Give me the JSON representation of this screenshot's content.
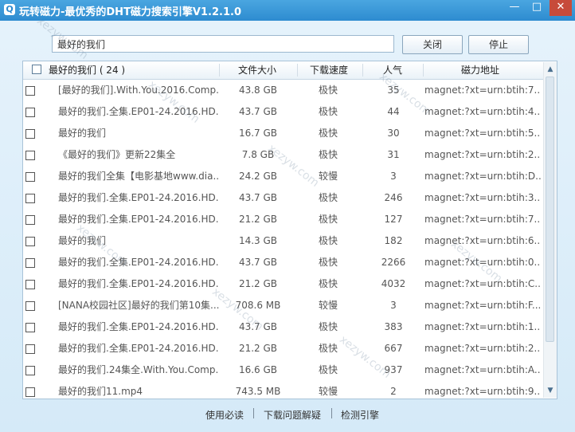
{
  "window": {
    "title": "玩转磁力-最优秀的DHT磁力搜索引擎V1.2.1.0",
    "minimize": "—",
    "maximize": "□",
    "close": "✕"
  },
  "search": {
    "value": "最好的我们"
  },
  "buttons": {
    "close_label": "关闭",
    "stop_label": "停止"
  },
  "table": {
    "headers": {
      "name": "最好的我们 ( 24 )",
      "size": "文件大小",
      "speed": "下载速度",
      "popularity": "人气",
      "magnet": "磁力地址"
    },
    "rows": [
      {
        "name": "[最好的我们].With.You.2016.Comp...",
        "size": "43.8 GB",
        "speed": "极快",
        "popularity": "35",
        "magnet": "magnet:?xt=urn:btih:7..."
      },
      {
        "name": "最好的我们.全集.EP01-24.2016.HD...",
        "size": "43.7 GB",
        "speed": "极快",
        "popularity": "44",
        "magnet": "magnet:?xt=urn:btih:4..."
      },
      {
        "name": "最好的我们",
        "size": "16.7 GB",
        "speed": "极快",
        "popularity": "30",
        "magnet": "magnet:?xt=urn:btih:5..."
      },
      {
        "name": "《最好的我们》更新22集全",
        "size": "7.8 GB",
        "speed": "极快",
        "popularity": "31",
        "magnet": "magnet:?xt=urn:btih:2..."
      },
      {
        "name": "最好的我们全集【电影基地www.dia...",
        "size": "24.2 GB",
        "speed": "较慢",
        "popularity": "3",
        "magnet": "magnet:?xt=urn:btih:D..."
      },
      {
        "name": "最好的我们.全集.EP01-24.2016.HD...",
        "size": "43.7 GB",
        "speed": "极快",
        "popularity": "246",
        "magnet": "magnet:?xt=urn:btih:3..."
      },
      {
        "name": "最好的我们.全集.EP01-24.2016.HD...",
        "size": "21.2 GB",
        "speed": "极快",
        "popularity": "127",
        "magnet": "magnet:?xt=urn:btih:7..."
      },
      {
        "name": "最好的我们",
        "size": "14.3 GB",
        "speed": "极快",
        "popularity": "182",
        "magnet": "magnet:?xt=urn:btih:6..."
      },
      {
        "name": "最好的我们.全集.EP01-24.2016.HD...",
        "size": "43.7 GB",
        "speed": "极快",
        "popularity": "2266",
        "magnet": "magnet:?xt=urn:btih:0..."
      },
      {
        "name": "最好的我们.全集.EP01-24.2016.HD...",
        "size": "21.2 GB",
        "speed": "极快",
        "popularity": "4032",
        "magnet": "magnet:?xt=urn:btih:C..."
      },
      {
        "name": "[NANA校园社区]最好的我们第10集...",
        "size": "708.6 MB",
        "speed": "较慢",
        "popularity": "3",
        "magnet": "magnet:?xt=urn:btih:F..."
      },
      {
        "name": "最好的我们.全集.EP01-24.2016.HD...",
        "size": "43.7 GB",
        "speed": "极快",
        "popularity": "383",
        "magnet": "magnet:?xt=urn:btih:1..."
      },
      {
        "name": "最好的我们.全集.EP01-24.2016.HD...",
        "size": "21.2 GB",
        "speed": "极快",
        "popularity": "667",
        "magnet": "magnet:?xt=urn:btih:2..."
      },
      {
        "name": "最好的我们.24集全.With.You.Comp...",
        "size": "16.6 GB",
        "speed": "极快",
        "popularity": "937",
        "magnet": "magnet:?xt=urn:btih:A..."
      },
      {
        "name": "最好的我们11.mp4",
        "size": "743.5 MB",
        "speed": "较慢",
        "popularity": "2",
        "magnet": "magnet:?xt=urn:btih:9..."
      }
    ]
  },
  "footer": {
    "links": [
      "使用必读",
      "下载问题解疑",
      "检测引擎"
    ]
  },
  "watermark": "xezyw.com",
  "colors": {
    "titlebar": "#2d8bd0",
    "accent": "#4aa6e0"
  },
  "icons": {
    "app": "magnet-search-icon",
    "scroll_up": "chevron-up-icon",
    "scroll_down": "chevron-down-icon"
  }
}
